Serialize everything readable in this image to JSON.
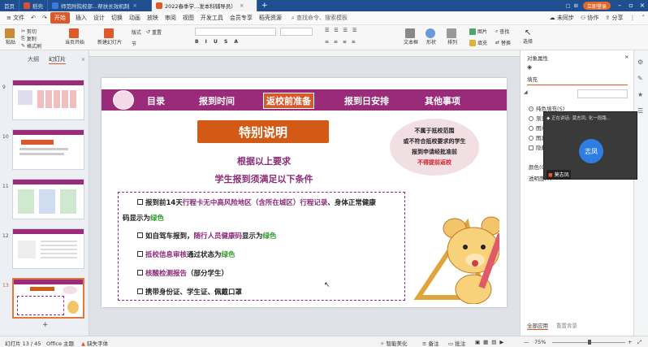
{
  "tabs": [
    {
      "label": "首页",
      "icon_color": "#ffffff"
    },
    {
      "label": "稻壳",
      "icon_color": "#e04a3a"
    },
    {
      "label": "师范附院校部...帮扶长效机制",
      "icon_color": "#3a7be0"
    },
    {
      "label": "2022春季学...发本科辅导员）",
      "icon_color": "#e0592b"
    }
  ],
  "login_button": "立即登录",
  "menu": {
    "file": "文件",
    "start": "开始",
    "items": [
      "插入",
      "设计",
      "切换",
      "动画",
      "放映",
      "审阅",
      "视图",
      "开发工具",
      "会员专享",
      "稻壳资源"
    ],
    "search": "查找命令、搜索模板",
    "right": [
      "未同步",
      "协作",
      "分享"
    ]
  },
  "ribbon": {
    "paste": "粘贴",
    "cut": "剪切",
    "copy": "复制",
    "format_painter": "格式刷",
    "from_current": "当页开始",
    "new_slide": "新建幻灯片",
    "layout": "版式",
    "section": "节",
    "reset": "重置",
    "textbox": "文本框",
    "shape": "形状",
    "arrange": "排列",
    "picture": "图片",
    "fill": "填充",
    "find": "查找",
    "replace": "替换",
    "select": "选择"
  },
  "left_panel": {
    "tabs": [
      "大纲",
      "幻灯片"
    ],
    "slide_numbers": [
      "9",
      "10",
      "11",
      "12",
      "13"
    ]
  },
  "slide": {
    "nav": [
      "目录",
      "报到时间",
      "返校前准备",
      "报到日安排",
      "其他事项"
    ],
    "special_title": "特别说明",
    "subhead1": "根据以上要求",
    "subhead2": "学生报到须满足以下条件",
    "bubble": [
      "不属于抵校范围",
      "或不符合抵校要求的学生",
      "报到申请经批准前",
      "不得提前返校"
    ],
    "item1": {
      "a": "报到前14天",
      "b": "行程卡无中高风险地区（含所在城区）行程记录",
      "c": "、身体正常健康",
      "d": "码显示为",
      "e": "绿色"
    },
    "item2": {
      "a": "如自驾车报到，",
      "b": "随行人员健康码",
      "c": "显示为",
      "d": "绿色"
    },
    "item3": {
      "a": "抵校信息审核",
      "b": "通过状态为",
      "c": "绿色"
    },
    "item4": {
      "a": "核酸检测报告",
      "b": "（部分学生）"
    },
    "item5": {
      "a": "携带身份证、学生证、佩戴口罩"
    }
  },
  "right_panel": {
    "title": "对象属性",
    "section": "填充",
    "options": [
      "纯色填充(S)",
      "渐变",
      "图片",
      "图案",
      "隐藏"
    ],
    "color_label": "颜色(C)",
    "transparency_label": "透明度(T)",
    "apply_all": "全部应用",
    "reset_bg": "重置背景"
  },
  "video": {
    "speaking": "正在讲话: 莫志凤; 化一段路...",
    "avatar_text": "志凤",
    "name": "莫志凤"
  },
  "status": {
    "slide_pos": "幻灯片 13 / 45",
    "theme": "Office 主题",
    "font_missing": "缺失字体",
    "smart_beautify": "智能美化",
    "notes": "备注",
    "comments": "批注",
    "zoom": "75%"
  },
  "colors": {
    "accent": "#d9592b",
    "banner": "#9a2b7a",
    "title_bar": "#1f4f8f"
  }
}
